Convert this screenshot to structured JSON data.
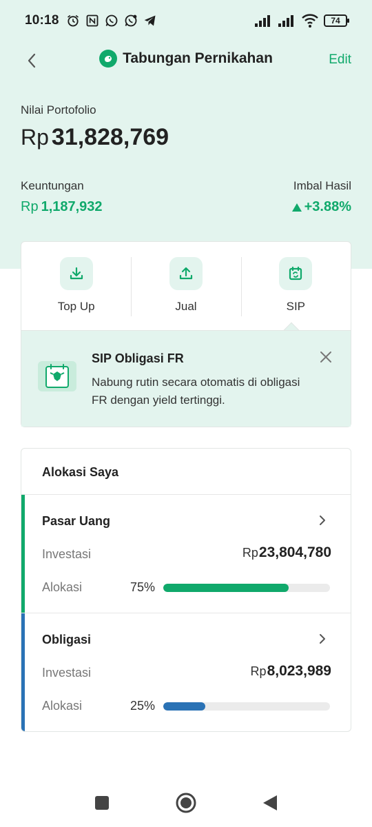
{
  "status_bar": {
    "time": "10:18",
    "battery": "74",
    "icons": [
      "alarm-icon",
      "nfc-icon",
      "whatsapp-icon",
      "whatsapp-business-icon",
      "telegram-icon"
    ]
  },
  "header": {
    "title": "Tabungan Pernikahan",
    "edit_label": "Edit"
  },
  "portfolio": {
    "label": "Nilai Portofolio",
    "currency": "Rp",
    "value": "31,828,769",
    "gain_label": "Keuntungan",
    "gain_currency": "Rp",
    "gain_value": "1,187,932",
    "return_label": "Imbal Hasil",
    "return_value": "+3.88%"
  },
  "actions": [
    {
      "label": "Top Up",
      "icon": "download-icon"
    },
    {
      "label": "Jual",
      "icon": "upload-icon"
    },
    {
      "label": "SIP",
      "icon": "calendar-refresh-icon"
    }
  ],
  "sip_banner": {
    "title": "SIP Obligasi FR",
    "description": "Nabung rutin secara otomatis di obligasi FR dengan yield tertinggi."
  },
  "allocation": {
    "title": "Alokasi Saya",
    "sections": [
      {
        "name": "Pasar Uang",
        "investment_label": "Investasi",
        "currency": "Rp",
        "investment_value": "23,804,780",
        "allocation_label": "Alokasi",
        "allocation_pct": "75%",
        "allocation_fraction": 0.75,
        "color": "#10a96b"
      },
      {
        "name": "Obligasi",
        "investment_label": "Investasi",
        "currency": "Rp",
        "investment_value": "8,023,989",
        "allocation_label": "Alokasi",
        "allocation_pct": "25%",
        "allocation_fraction": 0.25,
        "color": "#2a72b5"
      }
    ]
  },
  "colors": {
    "brand": "#10a96b",
    "header_bg": "#e3f4ee",
    "obligasi": "#2a72b5"
  }
}
